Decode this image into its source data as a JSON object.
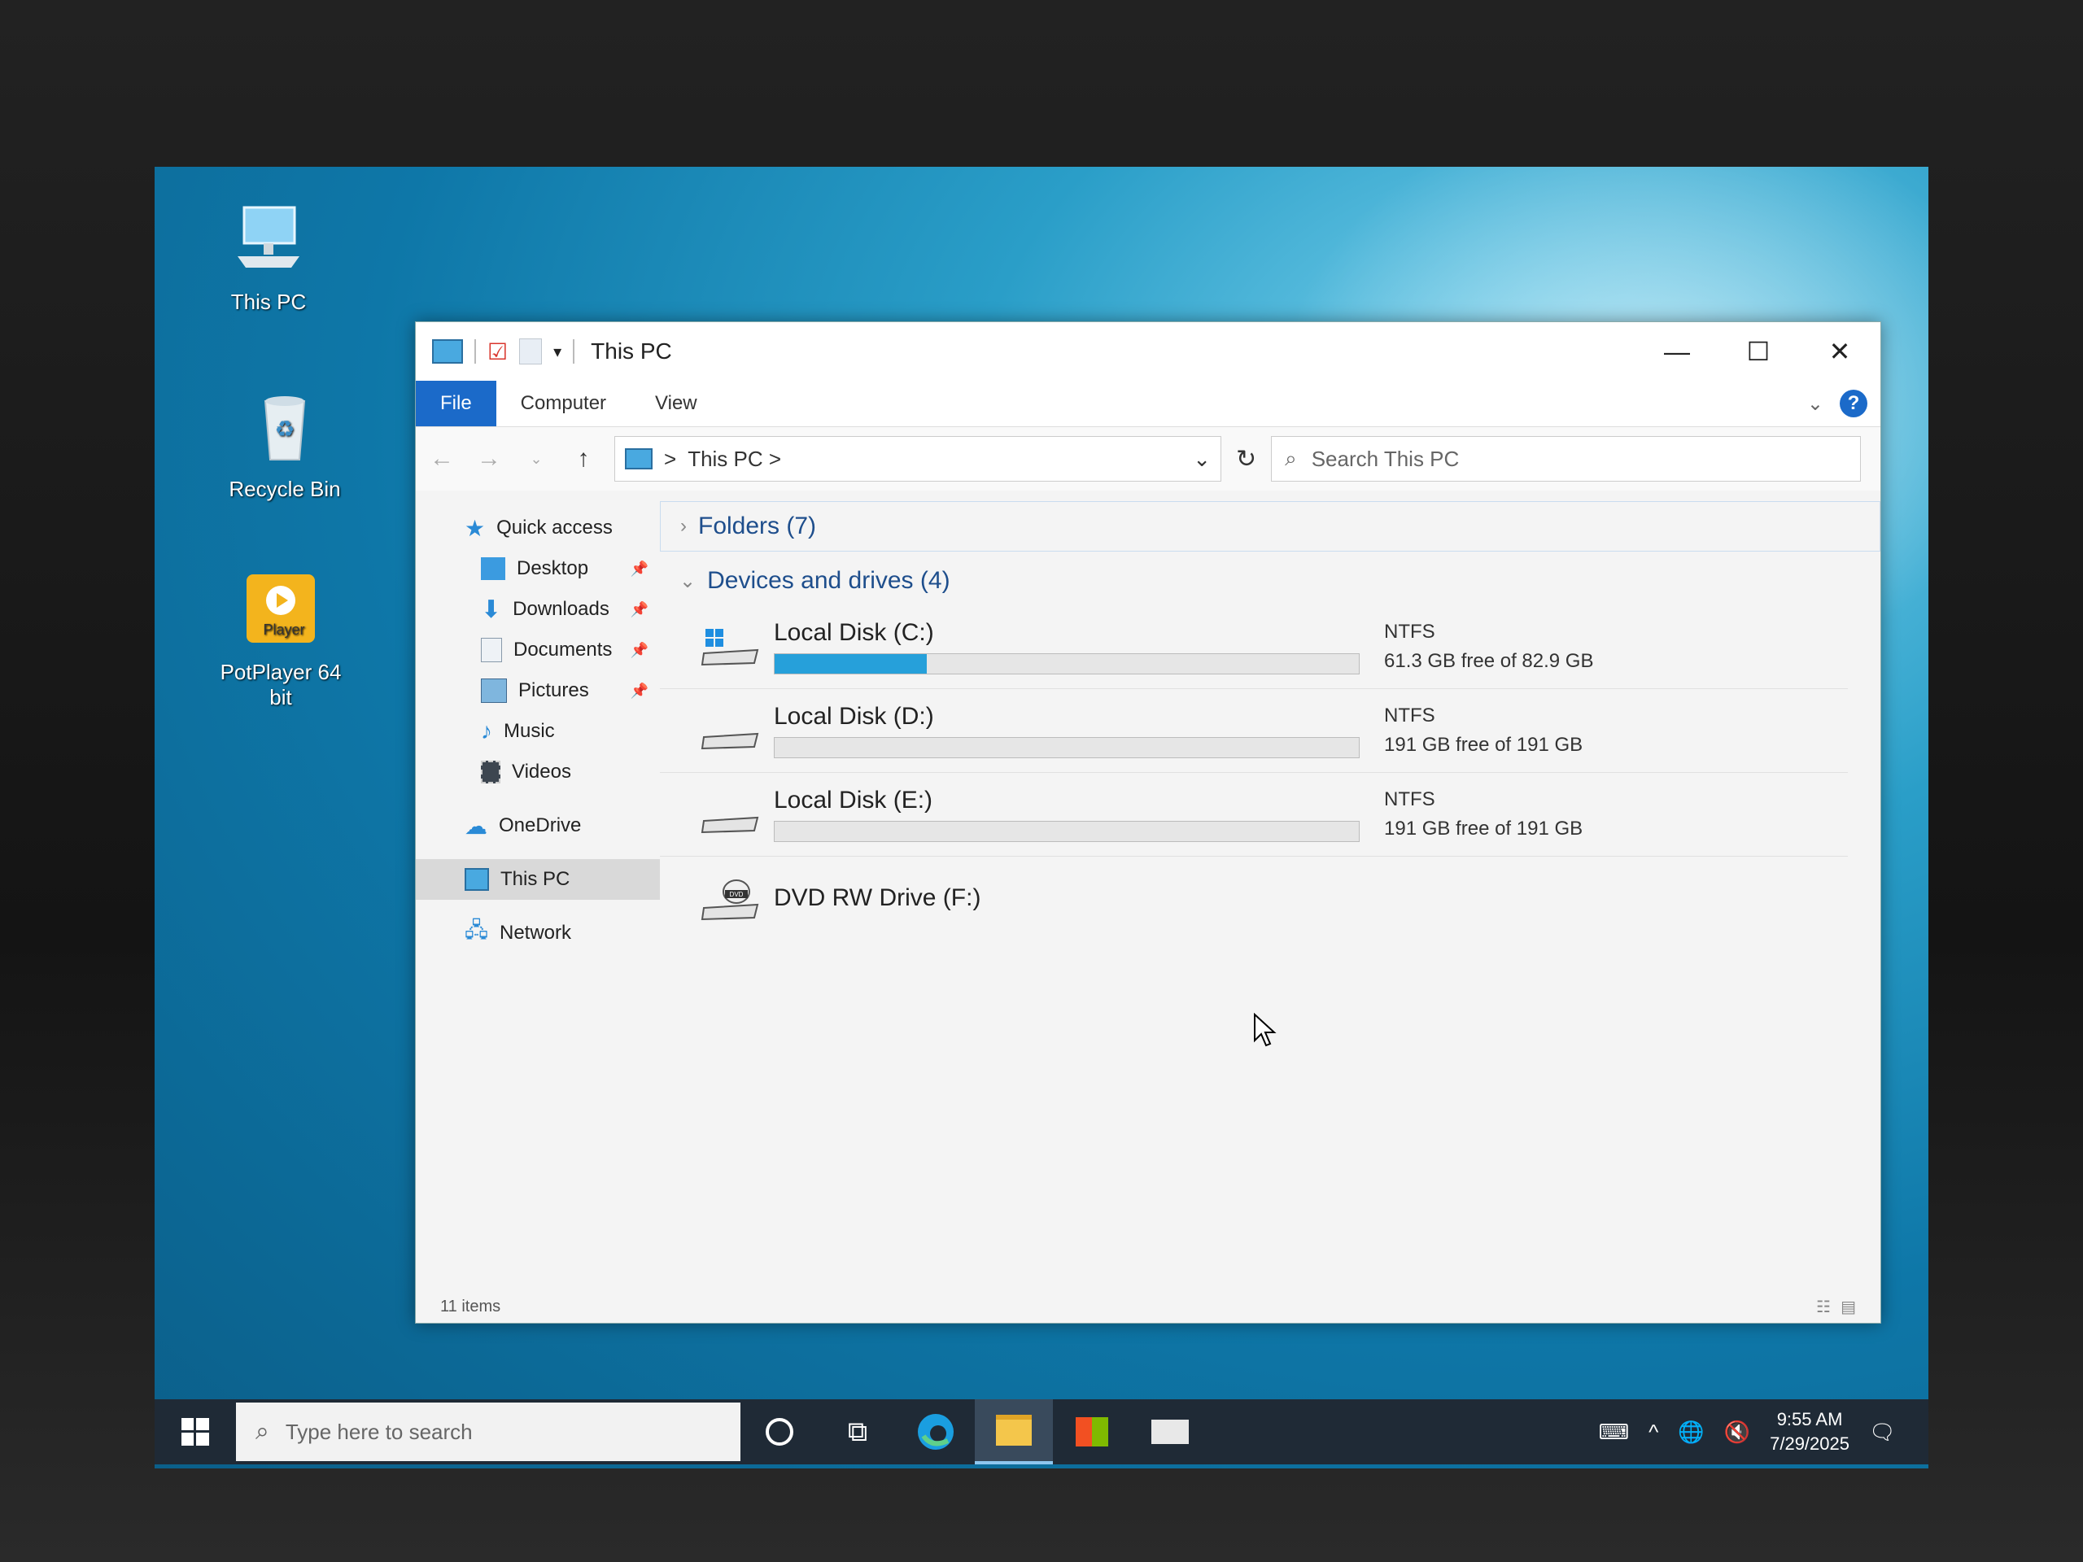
{
  "desktop": {
    "icons": [
      {
        "label": "This PC"
      },
      {
        "label": "Recycle Bin"
      },
      {
        "label": "PotPlayer 64 bit",
        "badge": "Player"
      }
    ]
  },
  "window": {
    "title": "This PC",
    "ribbon": {
      "tabs": [
        "File",
        "Computer",
        "View"
      ]
    },
    "address": {
      "crumb": "This PC",
      "separator": ">"
    },
    "search_placeholder": "Search This PC",
    "nav": {
      "quick_access": "Quick access",
      "pinned": [
        "Desktop",
        "Downloads",
        "Documents",
        "Pictures"
      ],
      "unpinned": [
        "Music",
        "Videos"
      ],
      "onedrive": "OneDrive",
      "this_pc": "This PC",
      "network": "Network"
    },
    "groups": {
      "folders": "Folders (7)",
      "devices": "Devices and drives (4)"
    },
    "drives": [
      {
        "name": "Local Disk (C:)",
        "fs": "NTFS",
        "free": "61.3 GB free of 82.9 GB",
        "used_fraction": 0.26
      },
      {
        "name": "Local Disk (D:)",
        "fs": "NTFS",
        "free": "191 GB free of 191 GB",
        "used_fraction": 0.0
      },
      {
        "name": "Local Disk (E:)",
        "fs": "NTFS",
        "free": "191 GB free of 191 GB",
        "used_fraction": 0.0
      },
      {
        "name": "DVD RW Drive (F:)",
        "dvd_badge": "DVD"
      }
    ],
    "status": "11 items"
  },
  "taskbar": {
    "search_placeholder": "Type here to search",
    "time": "9:55 AM",
    "date": "7/29/2025"
  },
  "colors": {
    "accent": "#1b6ac9",
    "bar_fill": "#26a0da",
    "taskbar": "#1f2a36"
  }
}
